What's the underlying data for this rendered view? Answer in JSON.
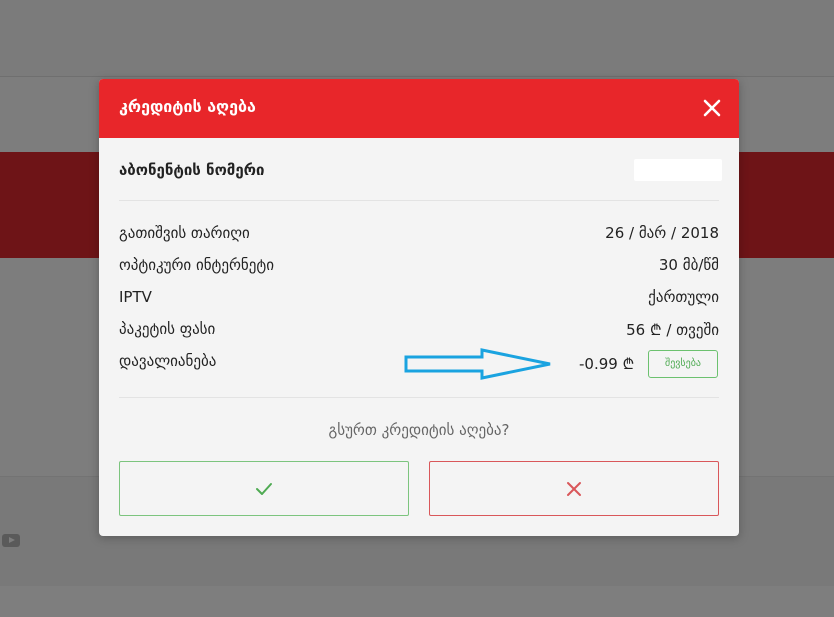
{
  "modal": {
    "title": "კრედიტის აღება",
    "subscriber_label": "აბონენტის ნომერი",
    "details": [
      {
        "label": "გათიშვის თარიღი",
        "value": "26 / მარ / 2018"
      },
      {
        "label": "ოპტიკური ინტერნეტი",
        "value": "30 მბ/წმ"
      },
      {
        "label": "IPTV",
        "value": "ქართული"
      },
      {
        "label": "პაკეტის ფასი",
        "value": "56 ₾ / თვეში"
      }
    ],
    "balance": {
      "label": "დავალიანება",
      "value": "-0.99 ₾",
      "history_button": "შევსება"
    },
    "question": "გსურთ კრედიტის აღება?",
    "colors": {
      "header": "#e8262a",
      "confirm": "#4eaa52",
      "cancel": "#d9575a",
      "arrow": "#1aa3e0"
    },
    "icons": {
      "close": "close-icon",
      "confirm": "check-icon",
      "cancel": "x-icon"
    }
  }
}
